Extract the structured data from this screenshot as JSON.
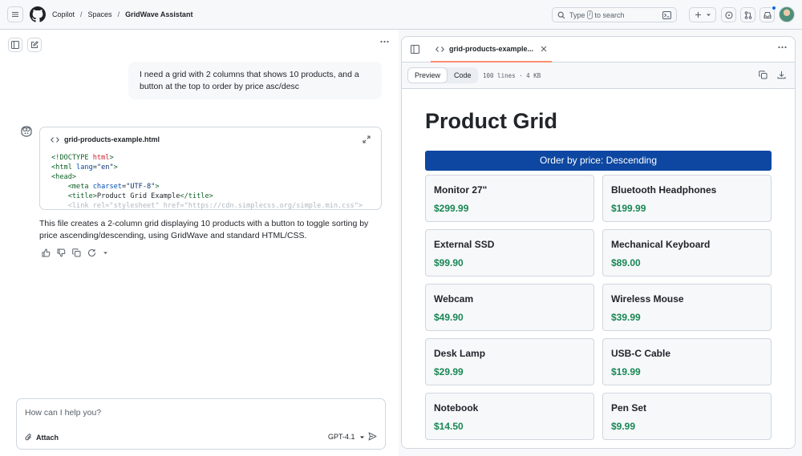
{
  "header": {
    "breadcrumbs": [
      "Copilot",
      "Spaces",
      "GridWave Assistant"
    ],
    "search_label": "Type",
    "search_key": "/",
    "search_suffix": "to search"
  },
  "chat": {
    "user_message": "I need a grid with 2 columns that shows 10 products, and a button at the top to order by price asc/desc",
    "code_card_title": "grid-products-example.html",
    "code_lines": [
      "<!DOCTYPE html>",
      "<html lang=\"en\">",
      "<head>",
      "    <meta charset=\"UTF-8\">",
      "    <title>Product Grid Example</title>",
      "    <link rel=\"stylesheet\" href=\"https://cdn.simplecss.org/simple.min.css\">"
    ],
    "assistant_message": "This file creates a 2-column grid displaying 10 products with a button to toggle sorting by price ascending/descending, using GridWave and standard HTML/CSS.",
    "composer_placeholder": "How can I help you?",
    "attach_label": "Attach",
    "model_label": "GPT-4.1"
  },
  "preview_panel": {
    "file_tab": "grid-products-example...",
    "tabs": [
      "Preview",
      "Code"
    ],
    "active_tab": "Preview",
    "file_meta": "100 lines · 4 KB",
    "page_title": "Product Grid",
    "sort_button": "Order by price: Descending",
    "products": [
      {
        "name": "Monitor 27\"",
        "price": "$299.99"
      },
      {
        "name": "Bluetooth Headphones",
        "price": "$199.99"
      },
      {
        "name": "External SSD",
        "price": "$99.90"
      },
      {
        "name": "Mechanical Keyboard",
        "price": "$89.00"
      },
      {
        "name": "Webcam",
        "price": "$49.90"
      },
      {
        "name": "Wireless Mouse",
        "price": "$39.99"
      },
      {
        "name": "Desk Lamp",
        "price": "$29.99"
      },
      {
        "name": "USB-C Cable",
        "price": "$19.99"
      },
      {
        "name": "Notebook",
        "price": "$14.50"
      },
      {
        "name": "Pen Set",
        "price": "$9.99"
      }
    ]
  },
  "colors": {
    "sort_button_bg": "#0d47a1",
    "price_green": "#198754",
    "active_tab_underline": "#fd8c73",
    "notification_dot": "#0969da"
  }
}
